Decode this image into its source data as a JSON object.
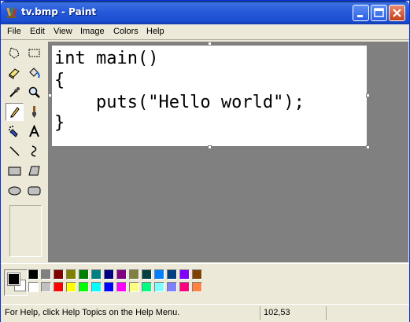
{
  "window": {
    "title": "tv.bmp - Paint"
  },
  "menu": [
    "File",
    "Edit",
    "View",
    "Image",
    "Colors",
    "Help"
  ],
  "tools": [
    "free-form-select",
    "select",
    "eraser",
    "fill-with-color",
    "pick-color",
    "magnifier",
    "pencil",
    "brush",
    "airbrush",
    "text",
    "line",
    "curve",
    "rectangle",
    "polygon",
    "ellipse",
    "rounded-rectangle"
  ],
  "selected_tool": "pencil",
  "canvas": {
    "lines": [
      "int main()",
      "{",
      "    puts(\"Hello world\");",
      "}"
    ]
  },
  "palette": {
    "foreground": "#000000",
    "background": "#ffffff",
    "row1": [
      "#000000",
      "#808080",
      "#800000",
      "#808000",
      "#008000",
      "#008080",
      "#000080",
      "#800080",
      "#808040",
      "#004040",
      "#0080ff",
      "#004080",
      "#8000ff",
      "#804000"
    ],
    "row2": [
      "#ffffff",
      "#c0c0c0",
      "#ff0000",
      "#ffff00",
      "#00ff00",
      "#00ffff",
      "#0000ff",
      "#ff00ff",
      "#ffff80",
      "#00ff80",
      "#80ffff",
      "#8080ff",
      "#ff0080",
      "#ff8040"
    ]
  },
  "status": {
    "help_text": "For Help, click Help Topics on the Help Menu.",
    "coords": "102,53"
  }
}
